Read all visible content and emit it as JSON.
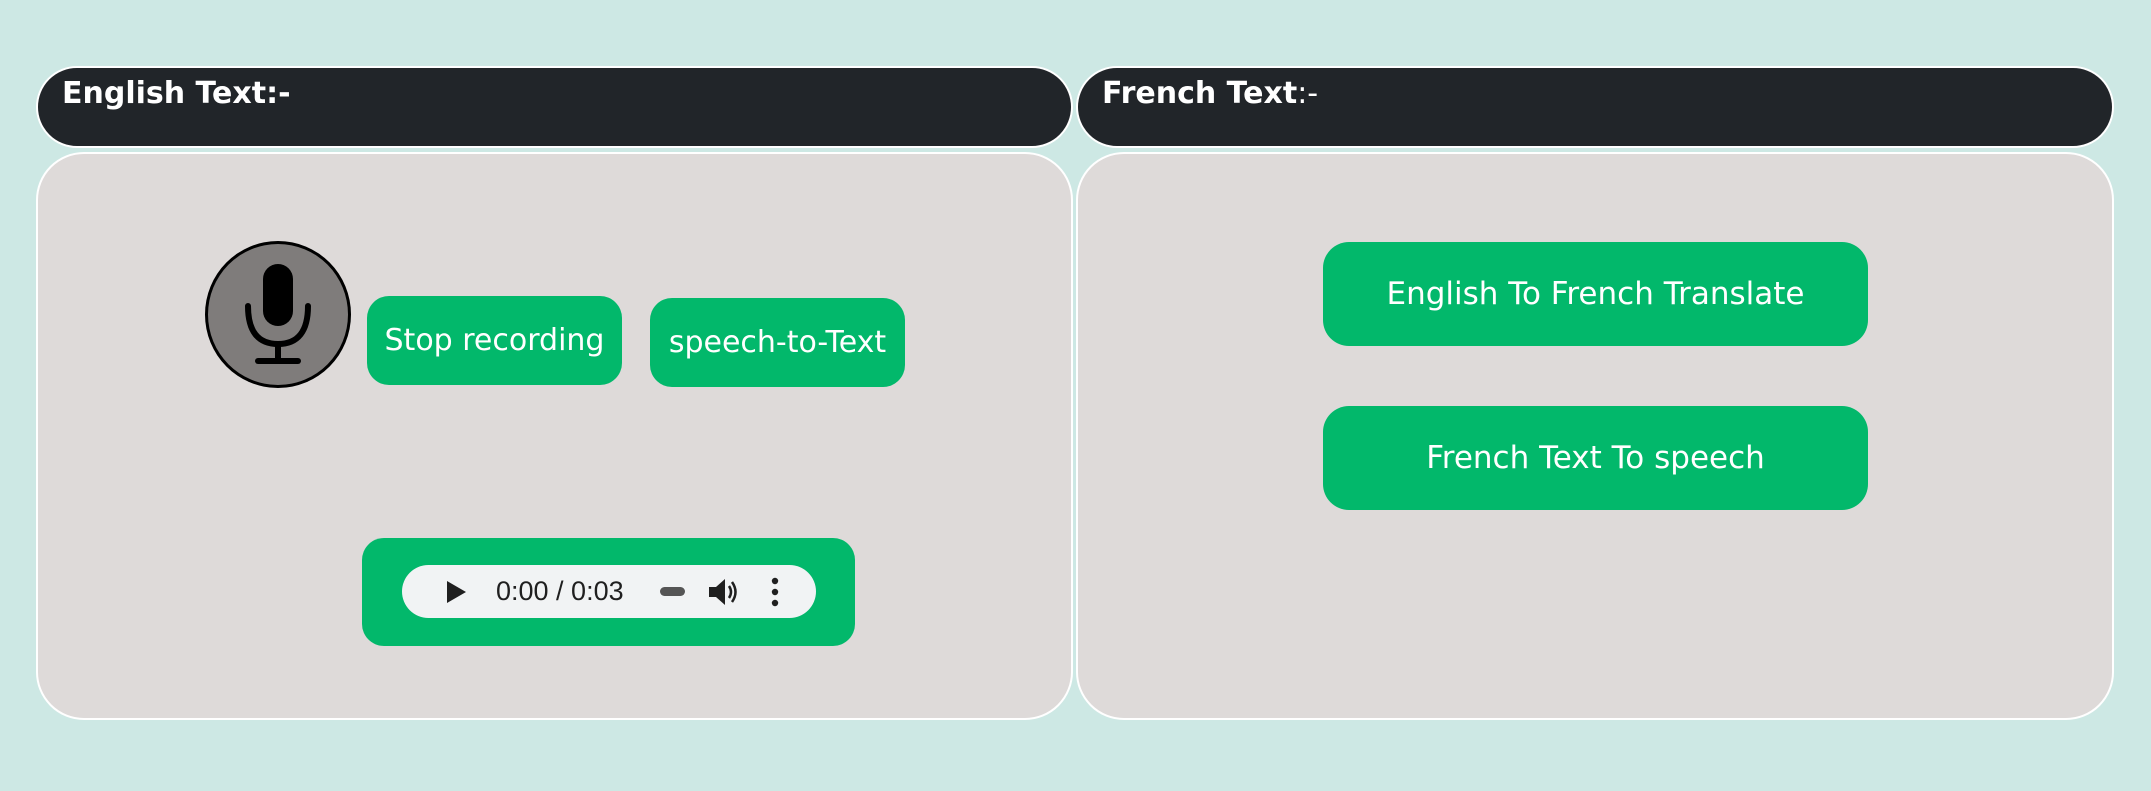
{
  "english_section": {
    "header_bold": "English Text:-",
    "header_rest": "",
    "mic_icon": "microphone-icon",
    "stop_recording_label": "Stop recording",
    "speech_to_text_label": "speech-to-Text",
    "audio_player": {
      "time": "0:00 / 0:03",
      "progress": 0,
      "icons": [
        "play-icon",
        "volume-icon",
        "more-options-icon"
      ]
    }
  },
  "french_section": {
    "header_bold": "French Text",
    "header_rest": ":-",
    "translate_label": "English To French Translate",
    "text_to_speech_label": "French Text To speech"
  },
  "colors": {
    "page_background": "#cde8e4",
    "header_background": "#212529",
    "panel_background": "#dedad9",
    "button_green": "#02b86b",
    "mic_gray": "#7f7c7b"
  }
}
